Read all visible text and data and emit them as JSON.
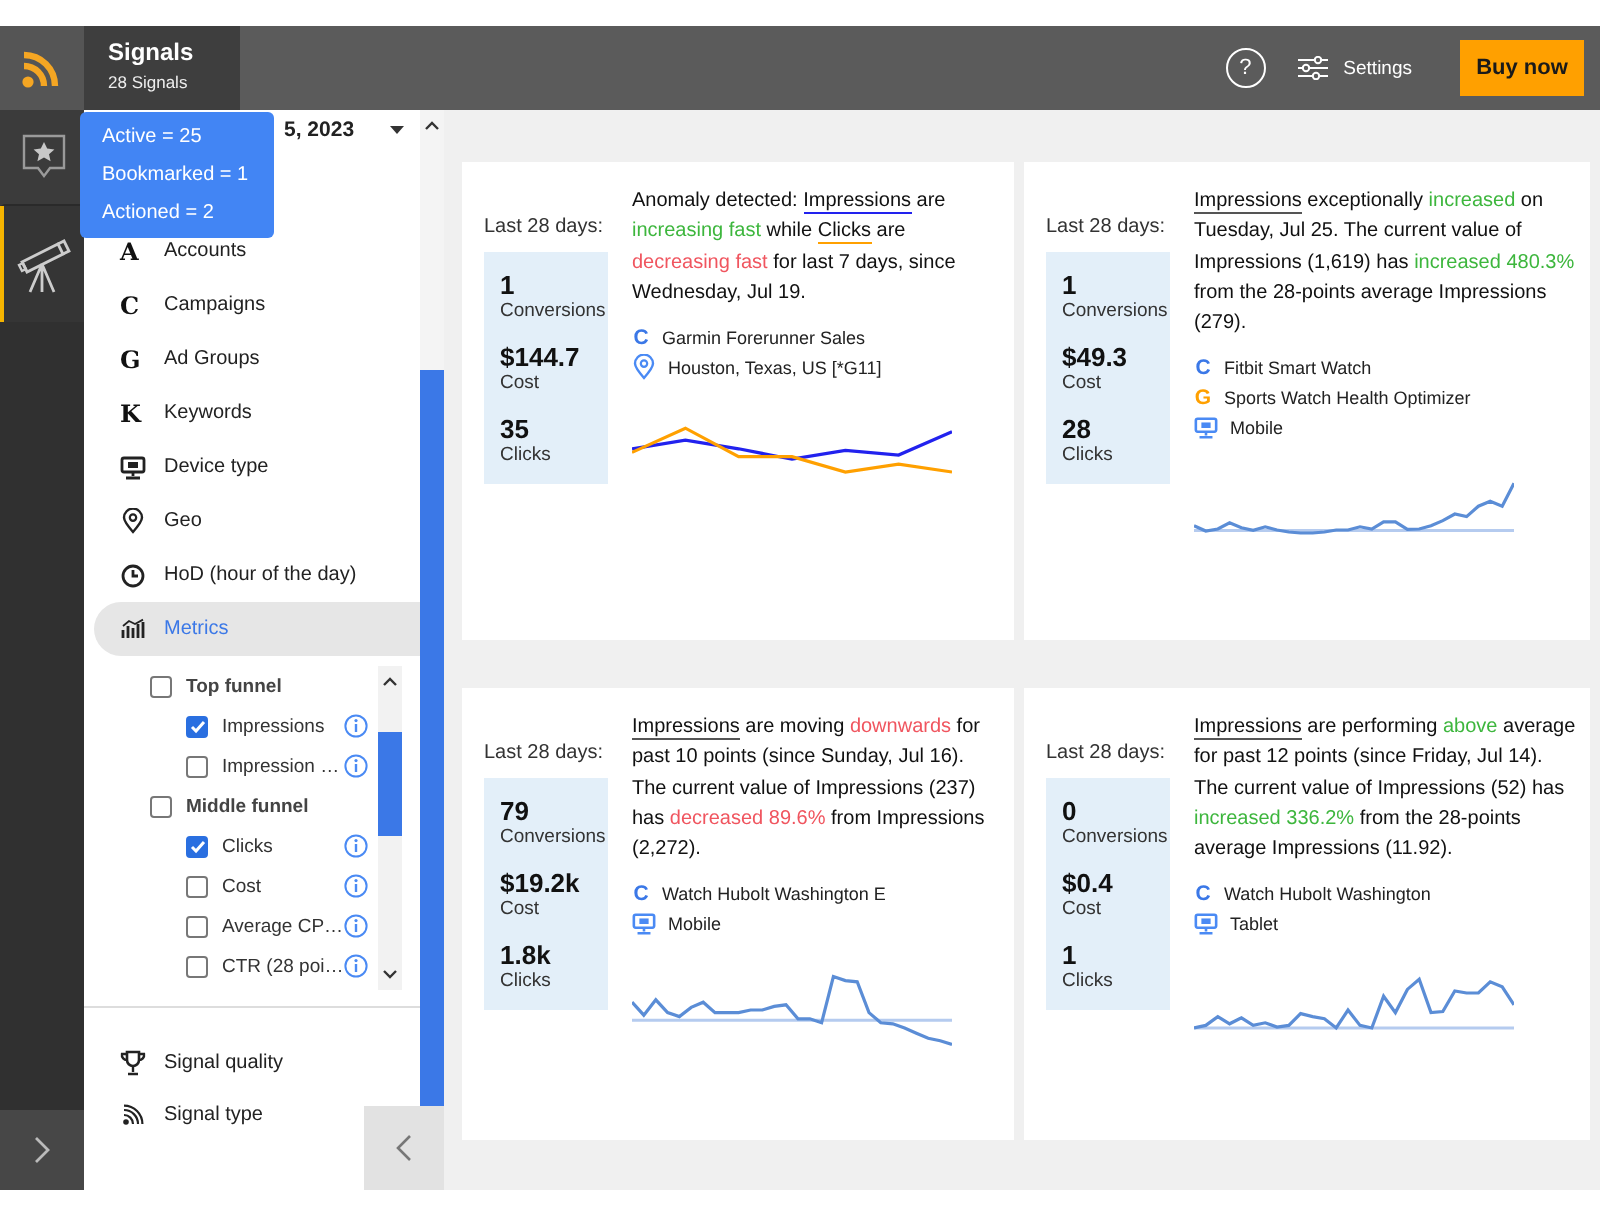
{
  "app": {
    "title": "Signals",
    "subtitle": "28 Signals"
  },
  "tooltip": {
    "lines": [
      "Active = 25",
      "Bookmarked = 1",
      "Actioned = 2"
    ]
  },
  "header": {
    "help": "?",
    "settings": "Settings",
    "buy": "Buy now"
  },
  "rail": [
    {
      "kind": "bookmark",
      "selected": false
    },
    {
      "kind": "telescope",
      "selected": true
    }
  ],
  "filter": {
    "date": "5, 2023"
  },
  "sidebar": {
    "items": [
      {
        "kind": "letter",
        "icon": "A",
        "label": "Accounts",
        "selected": false
      },
      {
        "kind": "letter",
        "icon": "C",
        "label": "Campaigns",
        "selected": false
      },
      {
        "kind": "letter",
        "icon": "G",
        "label": "Ad Groups",
        "selected": false
      },
      {
        "kind": "letter",
        "icon": "K",
        "label": "Keywords",
        "selected": false
      },
      {
        "kind": "device",
        "label": "Device type",
        "selected": false
      },
      {
        "kind": "geo",
        "label": "Geo",
        "selected": false
      },
      {
        "kind": "clock",
        "label": "HoD (hour of the day)",
        "selected": false
      },
      {
        "kind": "metrics",
        "label": "Metrics",
        "selected": true,
        "children": [
          {
            "label": "Top funnel",
            "checked": false,
            "children": [
              {
                "label": "Impressions",
                "checked": true
              },
              {
                "label": "Impression …",
                "checked": false
              }
            ]
          },
          {
            "label": "Middle funnel",
            "checked": false,
            "children": [
              {
                "label": "Clicks",
                "checked": true
              },
              {
                "label": "Cost",
                "checked": false
              },
              {
                "label": "Average CP…",
                "checked": false
              },
              {
                "label": "CTR (28 poi…",
                "checked": false
              }
            ]
          }
        ]
      }
    ],
    "footer": [
      {
        "kind": "trophy",
        "label": "Signal quality"
      },
      {
        "kind": "rss",
        "label": "Signal type"
      }
    ]
  },
  "cards": [
    {
      "period": "Last 28 days:",
      "stats": [
        {
          "value": "1",
          "label": "Conversions"
        },
        {
          "value": "$144.7",
          "label": "Cost"
        },
        {
          "value": "35",
          "label": "Clicks"
        }
      ],
      "message": [
        {
          "kind": "plain",
          "text": "Anomaly detected: "
        },
        {
          "kind": "metric",
          "text": "Impressions",
          "color": "#2222ee"
        },
        {
          "kind": "plain",
          "text": " are "
        },
        {
          "kind": "up",
          "text": "increasing fast"
        },
        {
          "kind": "plain",
          "text": " while "
        },
        {
          "kind": "metric",
          "text": "Clicks",
          "color": "#ffa000"
        },
        {
          "kind": "plain",
          "text": " are "
        },
        {
          "kind": "down",
          "text": "decreasing fast"
        },
        {
          "kind": "plain",
          "text": " for last 7 days, since Wednesday, Jul 19."
        }
      ],
      "tags": [
        {
          "kind": "campaign",
          "icon": "C",
          "label": "Garmin Forerunner Sales"
        },
        {
          "kind": "geo",
          "label": "Houston, Texas, US [*G11]"
        }
      ]
    },
    {
      "period": "Last 28 days:",
      "stats": [
        {
          "value": "1",
          "label": "Conversions"
        },
        {
          "value": "$49.3",
          "label": "Cost"
        },
        {
          "value": "28",
          "label": "Clicks"
        }
      ],
      "message": [
        {
          "kind": "metric",
          "text": "Impressions",
          "color": "#555555"
        },
        {
          "kind": "plain",
          "text": " exceptionally "
        },
        {
          "kind": "up",
          "text": "increased"
        },
        {
          "kind": "plain",
          "text": " on Tuesday, Jul 25. The current value of Impressions (1,619) has "
        },
        {
          "kind": "up",
          "text": "increased 480.3%"
        },
        {
          "kind": "plain",
          "text": " from the 28-points average Impressions (279)."
        }
      ],
      "tags": [
        {
          "kind": "campaign",
          "icon": "C",
          "label": "Fitbit Smart Watch"
        },
        {
          "kind": "adgroup",
          "icon": "G",
          "label": "Sports Watch Health Optimizer"
        },
        {
          "kind": "device",
          "label": "Mobile"
        }
      ]
    },
    {
      "period": "Last 28 days:",
      "stats": [
        {
          "value": "79",
          "label": "Conversions"
        },
        {
          "value": "$19.2k",
          "label": "Cost"
        },
        {
          "value": "1.8k",
          "label": "Clicks"
        }
      ],
      "message": [
        {
          "kind": "metric",
          "text": "Impressions",
          "color": "#555555"
        },
        {
          "kind": "plain",
          "text": " are moving "
        },
        {
          "kind": "down",
          "text": "downwards"
        },
        {
          "kind": "plain",
          "text": " for past 10 points (since Sunday, Jul 16). The current value of Impressions (237) has "
        },
        {
          "kind": "down",
          "text": "decreased 89.6%"
        },
        {
          "kind": "plain",
          "text": " from Impressions (2,272)."
        }
      ],
      "tags": [
        {
          "kind": "campaign",
          "icon": "C",
          "label": "Watch Hubolt Washington E"
        },
        {
          "kind": "device",
          "label": "Mobile"
        }
      ]
    },
    {
      "period": "Last 28 days:",
      "stats": [
        {
          "value": "0",
          "label": "Conversions"
        },
        {
          "value": "$0.4",
          "label": "Cost"
        },
        {
          "value": "1",
          "label": "Clicks"
        }
      ],
      "message": [
        {
          "kind": "metric",
          "text": "Impressions",
          "color": "#555555"
        },
        {
          "kind": "plain",
          "text": " are performing "
        },
        {
          "kind": "up",
          "text": "above"
        },
        {
          "kind": "plain",
          "text": " average for past 12 points (since Friday, Jul 14). The current value of Impressions (52) has "
        },
        {
          "kind": "up",
          "text": "increased 336.2%"
        },
        {
          "kind": "plain",
          "text": " from the 28-points average Impressions (11.92)."
        }
      ],
      "tags": [
        {
          "kind": "campaign",
          "icon": "C",
          "label": "Watch Hubolt Washington"
        },
        {
          "kind": "device",
          "label": "Tablet"
        }
      ]
    }
  ]
}
